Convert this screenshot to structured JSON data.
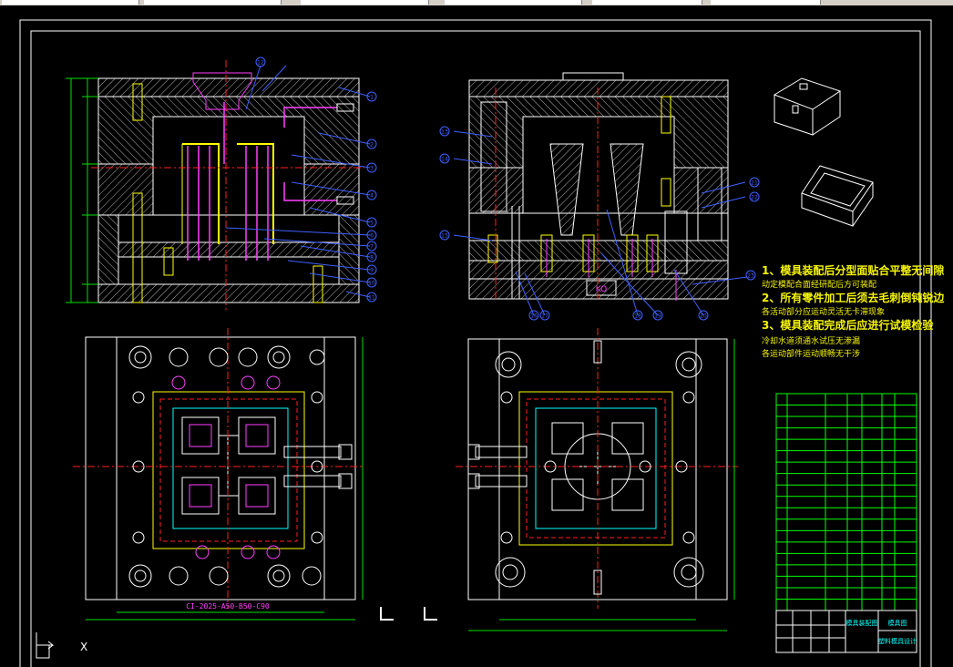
{
  "window": {
    "toolbar_segments": 6,
    "ucs_axis_x": "X"
  },
  "drawing": {
    "background": "#000000",
    "colors": {
      "frame": "#ffffff",
      "hatch": "#c8c8c8",
      "centerline": "#ff2020",
      "dimension": "#00e000",
      "leader": "#4060ff",
      "cavity": "#ffff00",
      "pin": "#ff40ff",
      "cooling": "#00ffff",
      "note_text": "#f5f500",
      "table": "#00ff00"
    },
    "plate_labels": [
      "KO"
    ],
    "spec_label": "CI-2025-A50-B50-C90",
    "notes": [
      "1、模具装配后分型面贴合平整无间隙",
      "动定模配合面经研配后方可装配",
      "2、所有零件加工后须去毛刺倒钝锐边",
      "各活动部分应运动灵活无卡滞现象",
      "3、模具装配完成后应进行试模检验",
      "冷却水道须通水试压无渗漏",
      "各运动部件运动顺畅无干涉"
    ],
    "balloons_left": [
      "1",
      "2",
      "3",
      "4",
      "5",
      "6",
      "7",
      "8",
      "9",
      "10",
      "11",
      "12"
    ],
    "balloons_right": [
      "13",
      "14",
      "15",
      "16",
      "17",
      "18",
      "19",
      "20",
      "21",
      "22",
      "23"
    ],
    "bom_row_count": 19,
    "title_block": {
      "cell_a": "模具装配图",
      "cell_b": "模具图",
      "cell_c": "塑料模具设计"
    }
  }
}
